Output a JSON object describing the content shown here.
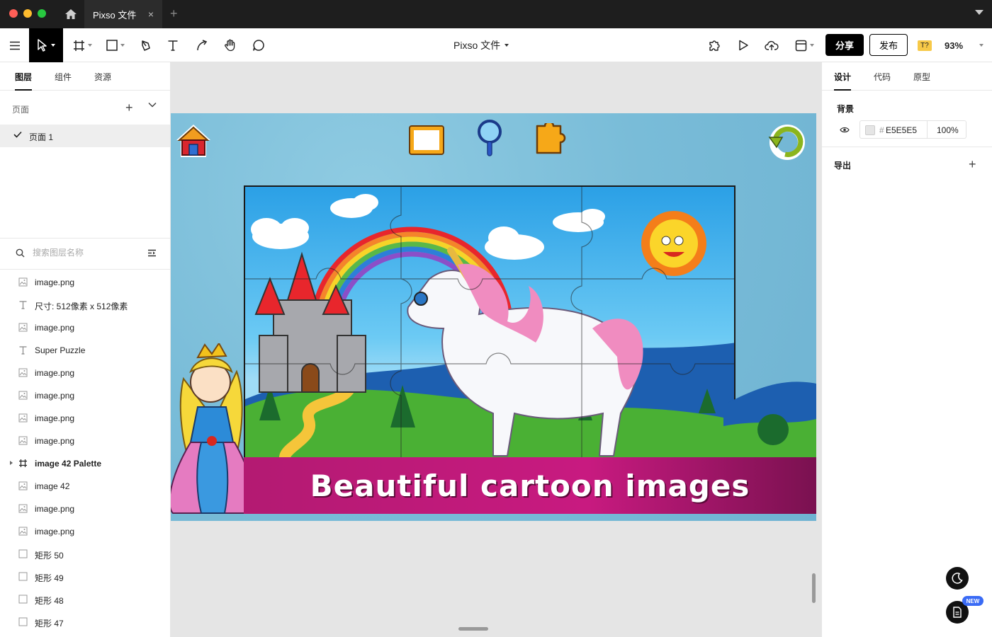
{
  "window": {
    "tab_title": "Pixso 文件",
    "tab_close": "×",
    "new_tab": "+"
  },
  "toolbar": {
    "doc_title": "Pixso 文件",
    "share_label": "分享",
    "publish_label": "发布",
    "font_badge": "T?",
    "zoom": "93%"
  },
  "left_panel": {
    "tabs": [
      "图层",
      "组件",
      "资源"
    ],
    "pages_label": "页面",
    "pages": [
      {
        "name": "页面 1",
        "selected": true
      }
    ],
    "search_placeholder": "搜索图层名称",
    "layers": [
      {
        "name": "image.png",
        "type": "image"
      },
      {
        "name": "尺寸:   512像素 x 512像素",
        "type": "text"
      },
      {
        "name": "image.png",
        "type": "image"
      },
      {
        "name": "Super Puzzle",
        "type": "text"
      },
      {
        "name": "image.png",
        "type": "image"
      },
      {
        "name": "image.png",
        "type": "image"
      },
      {
        "name": "image.png",
        "type": "image"
      },
      {
        "name": "image.png",
        "type": "image"
      },
      {
        "name": "image 42 Palette",
        "type": "frame"
      },
      {
        "name": "image 42",
        "type": "image"
      },
      {
        "name": "image.png",
        "type": "image"
      },
      {
        "name": "image.png",
        "type": "image"
      },
      {
        "name": "矩形 50",
        "type": "rect"
      },
      {
        "name": "矩形 49",
        "type": "rect"
      },
      {
        "name": "矩形 48",
        "type": "rect"
      },
      {
        "name": "矩形 47",
        "type": "rect"
      }
    ]
  },
  "canvas": {
    "banner_text": "Beautiful cartoon images"
  },
  "right_panel": {
    "tabs": [
      "设计",
      "代码",
      "原型"
    ],
    "background_title": "背景",
    "background_hex": "E5E5E5",
    "background_hash": "#",
    "background_opacity": "100%",
    "export_title": "导出",
    "new_badge": "NEW"
  },
  "colors": {
    "accent_dark": "#000000",
    "background_fill": "#E5E5E5",
    "banner_magenta": "#C81A80",
    "sky_blue": "#79BCD8"
  }
}
